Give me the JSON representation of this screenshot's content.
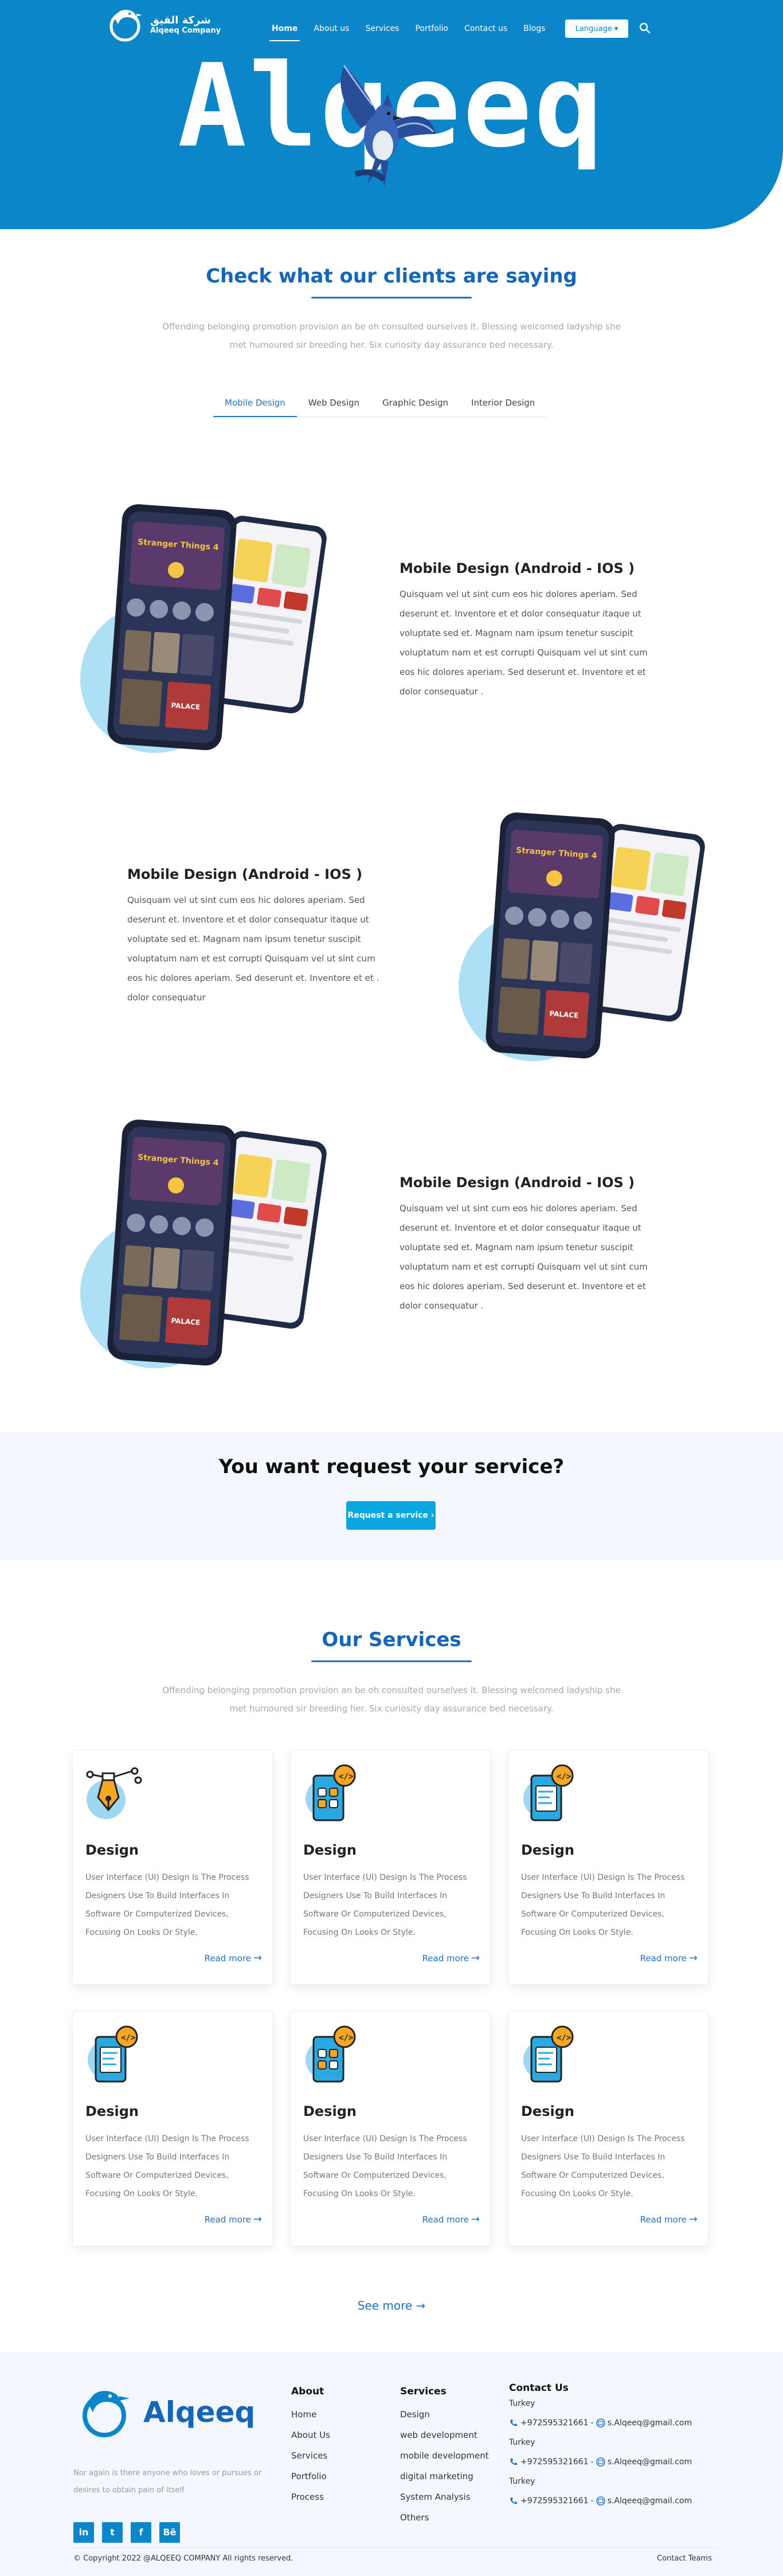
{
  "header": {
    "logo_ar": "شركة القيق",
    "logo_en": "Alqeeq Company",
    "nav": [
      "Home",
      "About us",
      "Services",
      "Portfolio",
      "Contact us",
      "Blogs"
    ],
    "language_label": "Language",
    "hero_title": "Alqeeq"
  },
  "testimonials": {
    "title": "Check what our clients are saying",
    "subtitle": "Offending belonging promotion provision an be oh consulted ourselves it. Blessing welcomed ladyship she met humoured sir breeding her. Six curiosity day assurance bed necessary.",
    "tabs": [
      "Mobile Design",
      "Web Design",
      "Graphic Design",
      "Interior Design"
    ],
    "active_tab": "Mobile Design"
  },
  "projects": [
    {
      "title": "Mobile Design (Android - IOS )",
      "body": "Quisquam vel ut sint cum eos hic dolores aperiam. Sed deserunt et. Inventore et et dolor consequatur itaque ut voluptate sed et. Magnam nam ipsum tenetur suscipit voluptatum nam et est corrupti Quisquam vel ut sint cum eos hic dolores aperiam. Sed deserunt et. Inventore et et dolor consequatur ."
    },
    {
      "title": "Mobile Design (Android - IOS )",
      "body": "Quisquam vel ut sint cum eos hic dolores aperiam. Sed deserunt et. Inventore et et dolor consequatur itaque ut voluptate sed et. Magnam nam ipsum tenetur suscipit voluptatum nam et est corrupti Quisquam vel ut sint cum eos hic dolores aperiam. Sed deserunt et. Inventore et et . dolor consequatur"
    },
    {
      "title": "Mobile Design (Android - IOS )",
      "body": "Quisquam vel ut sint cum eos hic dolores aperiam. Sed deserunt et. Inventore et et dolor consequatur itaque ut voluptate sed et. Magnam nam ipsum tenetur suscipit voluptatum nam et est corrupti Quisquam vel ut sint cum eos hic dolores aperiam. Sed deserunt et. Inventore et et dolor consequatur ."
    }
  ],
  "phone_screen": {
    "show_title": "Stranger Things 4",
    "poster_label": "PALACE",
    "card_label": "Stranger Things"
  },
  "request": {
    "title": "You want request your service?",
    "button": "Request a service"
  },
  "services": {
    "title": "Our Services",
    "subtitle": "Offending belonging promotion provision an be oh consulted ourselves it. Blessing welcomed ladyship she met humoured sir breeding her. Six curiosity day assurance bed necessary.",
    "cards": [
      {
        "title": "Design",
        "desc": "User Interface (UI) Design Is The Process Designers Use To Build Interfaces In Software Or Computerized Devices, Focusing On Looks Or Style.",
        "link": "Read more",
        "icon": "pen-tool-icon"
      },
      {
        "title": "Design",
        "desc": "User Interface (UI) Design Is The Process Designers Use To Build Interfaces In Software Or Computerized Devices, Focusing On Looks Or Style.",
        "link": "Read more",
        "icon": "mobile-apps-icon"
      },
      {
        "title": "Design",
        "desc": "User Interface (UI) Design Is The Process Designers Use To Build Interfaces In Software Or Computerized Devices, Focusing On Looks Or Style.",
        "link": "Read more",
        "icon": "mobile-code-icon"
      },
      {
        "title": "Design",
        "desc": "User Interface (UI) Design Is The Process Designers Use To Build Interfaces In Software Or Computerized Devices, Focusing On Looks Or Style.",
        "link": "Read more",
        "icon": "mobile-code-icon"
      },
      {
        "title": "Design",
        "desc": "User Interface (UI) Design Is The Process Designers Use To Build Interfaces In Software Or Computerized Devices, Focusing On Looks Or Style.",
        "link": "Read more",
        "icon": "mobile-apps-icon"
      },
      {
        "title": "Design",
        "desc": "User Interface (UI) Design Is The Process Designers Use To Build Interfaces In Software Or Computerized Devices, Focusing On Looks Or Style.",
        "link": "Read more",
        "icon": "mobile-code-icon"
      }
    ],
    "see_more": "See more"
  },
  "footer": {
    "logo_text": "Alqeeq",
    "tagline": "Nor again is there anyone who loves or pursues or desires to obtain pain of itself",
    "socials": [
      "in",
      "t",
      "f",
      "Bē"
    ],
    "about": {
      "title": "About",
      "items": [
        "Home",
        "About Us",
        "Services",
        "Portfolio",
        "Process"
      ]
    },
    "services": {
      "title": "Services",
      "items": [
        "Design",
        "web development",
        "mobile development",
        "digital marketing",
        "System Analysis",
        "Others"
      ]
    },
    "contact": {
      "title": "Contact Us",
      "entries": [
        {
          "country": "Turkey",
          "phone": "+972595321661",
          "email": "s.Alqeeq@gmail.com"
        },
        {
          "country": "Turkey",
          "phone": "+972595321661",
          "email": "s.Alqeeq@gmail.com"
        },
        {
          "country": "Turkey",
          "phone": "+972595321661",
          "email": "s.Alqeeq@gmail.com"
        }
      ]
    },
    "copyright": "© Copyright 2022 @ALQEEQ COMPANY All rights reserved.",
    "contact_teams": "Contact Teams"
  },
  "colors": {
    "brand": "#0b86c8",
    "accent": "#1d72c4",
    "button": "#0aa6e0"
  }
}
